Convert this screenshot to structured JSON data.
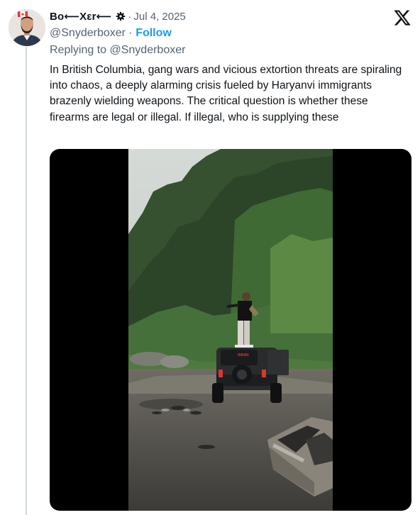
{
  "tweet": {
    "author_name": "Bo⟵Xεr⟵",
    "separator": "·",
    "date": "Jul 4, 2025",
    "handle": "@Snyderboxer",
    "handle_sep": " · ",
    "follow_label": "Follow",
    "replying_to": "Replying to @Snyderboxer",
    "text": "In British Columbia, gang wars and vicious extortion threats are spiraling into chaos, a deeply alarming crisis fueled by Haryanvi immigrants brazenly wielding weapons. The critical question is whether these firearms are legal or illegal. If illegal, who is supplying these",
    "vehicle_logo": "WRAN"
  },
  "icons": {
    "badge": "gear-badge-icon",
    "brand": "x-logo-icon",
    "flag": "canada-flag-icon"
  },
  "colors": {
    "accent": "#1d9bf0",
    "muted": "#536471",
    "text": "#0f1419",
    "thread_line": "#cfd9de"
  }
}
